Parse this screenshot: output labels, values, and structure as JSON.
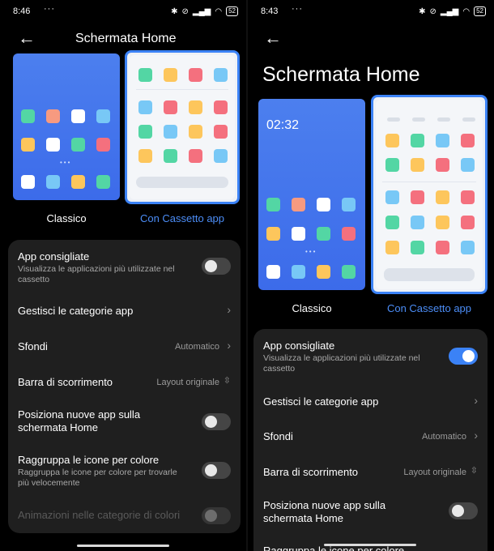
{
  "colors": {
    "accent": "#3b82f6",
    "background": "#000000",
    "card": "#1f1f1f",
    "subtext": "#a8a8a8"
  },
  "left": {
    "status": {
      "time": "8:46",
      "dots": "···",
      "battery": "52"
    },
    "title": "Schermata Home",
    "options": {
      "classic": "Classico",
      "drawer": "Con Cassetto app"
    },
    "settings": {
      "recommended_apps": {
        "title": "App consigliate",
        "subtitle": "Visualizza le applicazioni più utilizzate nel cassetto",
        "toggle": false
      },
      "manage_categories": {
        "title": "Gestisci le categorie app"
      },
      "wallpapers": {
        "title": "Sfondi",
        "value": "Automatico"
      },
      "scroll_bar": {
        "title": "Barra di scorrimento",
        "value": "Layout originale"
      },
      "new_apps": {
        "title": "Posiziona nuove app sulla schermata Home",
        "toggle": false
      },
      "group_color": {
        "title": "Raggruppa le icone per colore",
        "subtitle": "Raggruppa le icone per colore per trovarle più velocemente",
        "toggle": false
      },
      "color_animations": {
        "title": "Animazioni nelle categorie di colori",
        "toggle": false,
        "disabled": true
      }
    }
  },
  "right": {
    "status": {
      "time": "8:43",
      "dots": "···",
      "battery": "52"
    },
    "title": "Schermata Home",
    "clock": "02:32",
    "options": {
      "classic": "Classico",
      "drawer": "Con Cassetto app"
    },
    "settings": {
      "recommended_apps": {
        "title": "App consigliate",
        "subtitle": "Visualizza le applicazioni più utilizzate nel cassetto",
        "toggle": true
      },
      "manage_categories": {
        "title": "Gestisci le categorie app"
      },
      "wallpapers": {
        "title": "Sfondi",
        "value": "Automatico"
      },
      "scroll_bar": {
        "title": "Barra di scorrimento",
        "value": "Layout originale"
      },
      "new_apps": {
        "title": "Posiziona nuove app sulla schermata Home",
        "toggle": false
      },
      "group_color": {
        "title": "Raggruppa le icone per colore"
      }
    }
  }
}
